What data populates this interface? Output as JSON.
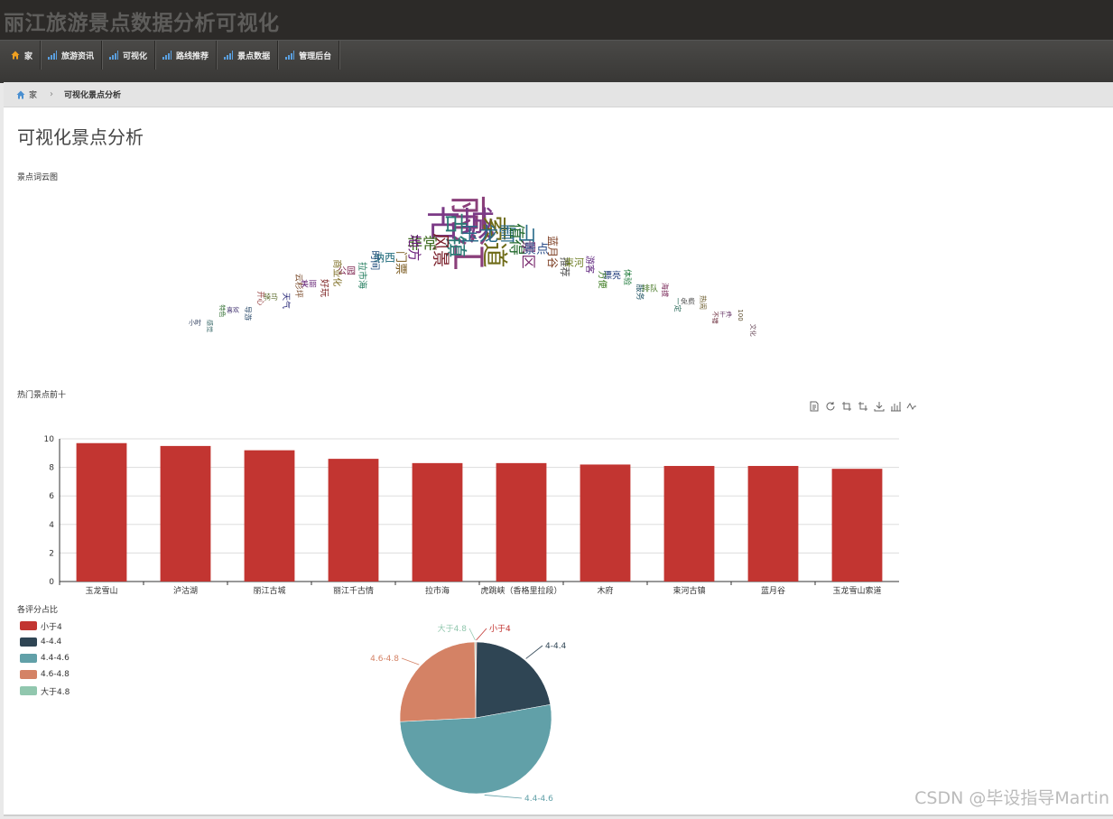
{
  "site_title": "丽江旅游景点数据分析可视化",
  "nav": [
    {
      "label": "家",
      "icon": "home-icon"
    },
    {
      "label": "旅游资讯",
      "icon": "signal-icon"
    },
    {
      "label": "可视化",
      "icon": "signal-icon"
    },
    {
      "label": "路线推荐",
      "icon": "signal-icon"
    },
    {
      "label": "景点数据",
      "icon": "signal-icon"
    },
    {
      "label": "管理后台",
      "icon": "signal-icon"
    }
  ],
  "breadcrumb": {
    "home": "家",
    "current": "可视化景点分析"
  },
  "page_title": "可视化景点分析",
  "wordcloud_label": "景点词云图",
  "bar_label": "热门景点前十",
  "pie_label": "各评分占比",
  "colors": {
    "bar": "#c23531",
    "pie": [
      "#c23531",
      "#2f4554",
      "#61a0a8",
      "#d48265",
      "#91c7ae"
    ]
  },
  "toolbox_icons": [
    "data-view-icon",
    "restore-icon",
    "zoom-icon",
    "zoom-reset-icon",
    "save-image-icon",
    "bar-type-icon",
    "line-type-icon"
  ],
  "wordcloud": {
    "words": [
      {
        "text": "丽江",
        "weight": 44,
        "color": "#8a3f7a"
      },
      {
        "text": "古城",
        "weight": 40,
        "color": "#7b3a86"
      },
      {
        "text": "索道",
        "weight": 30,
        "color": "#6d6a16"
      },
      {
        "text": "古镇",
        "weight": 26,
        "color": "#2a7a74"
      },
      {
        "text": "玉龙雪山",
        "weight": 22,
        "color": "#2a6b8a"
      },
      {
        "text": "风景",
        "weight": 20,
        "color": "#7a1f2a"
      },
      {
        "text": "值得",
        "weight": 19,
        "color": "#256b2f"
      },
      {
        "text": "非常",
        "weight": 18,
        "color": "#3d6a1e"
      },
      {
        "text": "景区",
        "weight": 17,
        "color": "#7a2a6e"
      },
      {
        "text": "地方",
        "weight": 16,
        "color": "#6a1e7a"
      },
      {
        "text": "景点",
        "weight": 15,
        "color": "#2e4f8a"
      },
      {
        "text": "门票",
        "weight": 14,
        "color": "#7a5a1e"
      },
      {
        "text": "蓝月谷",
        "weight": 13,
        "color": "#7a3a1e"
      },
      {
        "text": "纳西",
        "weight": 13,
        "color": "#1e6a7a"
      },
      {
        "text": "推荐",
        "weight": 12,
        "color": "#4a4a4a"
      },
      {
        "text": "时间",
        "weight": 12,
        "color": "#1e4a7a"
      },
      {
        "text": "束河",
        "weight": 12,
        "color": "#6a7a1e"
      },
      {
        "text": "拉市海",
        "weight": 11,
        "color": "#1e7a5a"
      },
      {
        "text": "游客",
        "weight": 11,
        "color": "#5a1e7a"
      },
      {
        "text": "公园",
        "weight": 11,
        "color": "#7a1e4a"
      },
      {
        "text": "方便",
        "weight": 10,
        "color": "#3a7a1e"
      },
      {
        "text": "商业化",
        "weight": 10,
        "color": "#7a6a1e"
      },
      {
        "text": "漂亮",
        "weight": 10,
        "color": "#1e3a7a"
      },
      {
        "text": "好玩",
        "weight": 10,
        "color": "#7a1e1e"
      },
      {
        "text": "体验",
        "weight": 9,
        "color": "#1e7a3a"
      },
      {
        "text": "美丽",
        "weight": 9,
        "color": "#6a2a7a"
      },
      {
        "text": "服务",
        "weight": 9,
        "color": "#2a5a6a"
      },
      {
        "text": "云杉坪",
        "weight": 9,
        "color": "#7a4a2a"
      },
      {
        "text": "排队",
        "weight": 9,
        "color": "#4a7a2a"
      },
      {
        "text": "天气",
        "weight": 9,
        "color": "#2a2a7a"
      },
      {
        "text": "海拔",
        "weight": 8,
        "color": "#7a2a5a"
      },
      {
        "text": "骑马",
        "weight": 8,
        "color": "#5a6a2a"
      },
      {
        "text": "一定",
        "weight": 8,
        "color": "#2a6a5a"
      },
      {
        "text": "开心",
        "weight": 8,
        "color": "#8a2a2a"
      },
      {
        "text": "免费",
        "weight": 8,
        "color": "#5a5a5a"
      },
      {
        "text": "导游",
        "weight": 8,
        "color": "#2a4a6a"
      },
      {
        "text": "热闹",
        "weight": 8,
        "color": "#6a5a2a"
      },
      {
        "text": "喜欢",
        "weight": 7,
        "color": "#3a2a6a"
      },
      {
        "text": "不错",
        "weight": 7,
        "color": "#6a2a3a"
      },
      {
        "text": "特色",
        "weight": 7,
        "color": "#2a6a2a"
      },
      {
        "text": "干净",
        "weight": 7,
        "color": "#6a3a6a"
      },
      {
        "text": "感觉",
        "weight": 7,
        "color": "#3a6a6a"
      },
      {
        "text": "100",
        "weight": 7,
        "color": "#5a4a2a"
      },
      {
        "text": "小时",
        "weight": 7,
        "color": "#2a3a5a"
      },
      {
        "text": "文化",
        "weight": 7,
        "color": "#6a4a5a"
      }
    ]
  },
  "chart_data": [
    {
      "type": "bar",
      "title": "热门景点前十",
      "categories": [
        "玉龙雪山",
        "泸沽湖",
        "丽江古城",
        "丽江千古情",
        "拉市海",
        "虎跳峡（香格里拉段）",
        "木府",
        "束河古镇",
        "蓝月谷",
        "玉龙雪山索道"
      ],
      "values": [
        9.7,
        9.5,
        9.2,
        8.6,
        8.3,
        8.3,
        8.2,
        8.1,
        8.1,
        7.9
      ],
      "ylim": [
        0,
        10
      ],
      "yticks": [
        0,
        2,
        4,
        6,
        8,
        10
      ],
      "grid": true
    },
    {
      "type": "pie",
      "title": "各评分占比",
      "legend_position": "top-left",
      "slices": [
        {
          "name": "小于4",
          "value": 0.2
        },
        {
          "name": "4-4.4",
          "value": 22
        },
        {
          "name": "4.4-4.6",
          "value": 52
        },
        {
          "name": "4.6-4.8",
          "value": 25.6
        },
        {
          "name": "大于4.8",
          "value": 0.2
        }
      ]
    }
  ],
  "watermark": "CSDN @毕设指导Martin"
}
